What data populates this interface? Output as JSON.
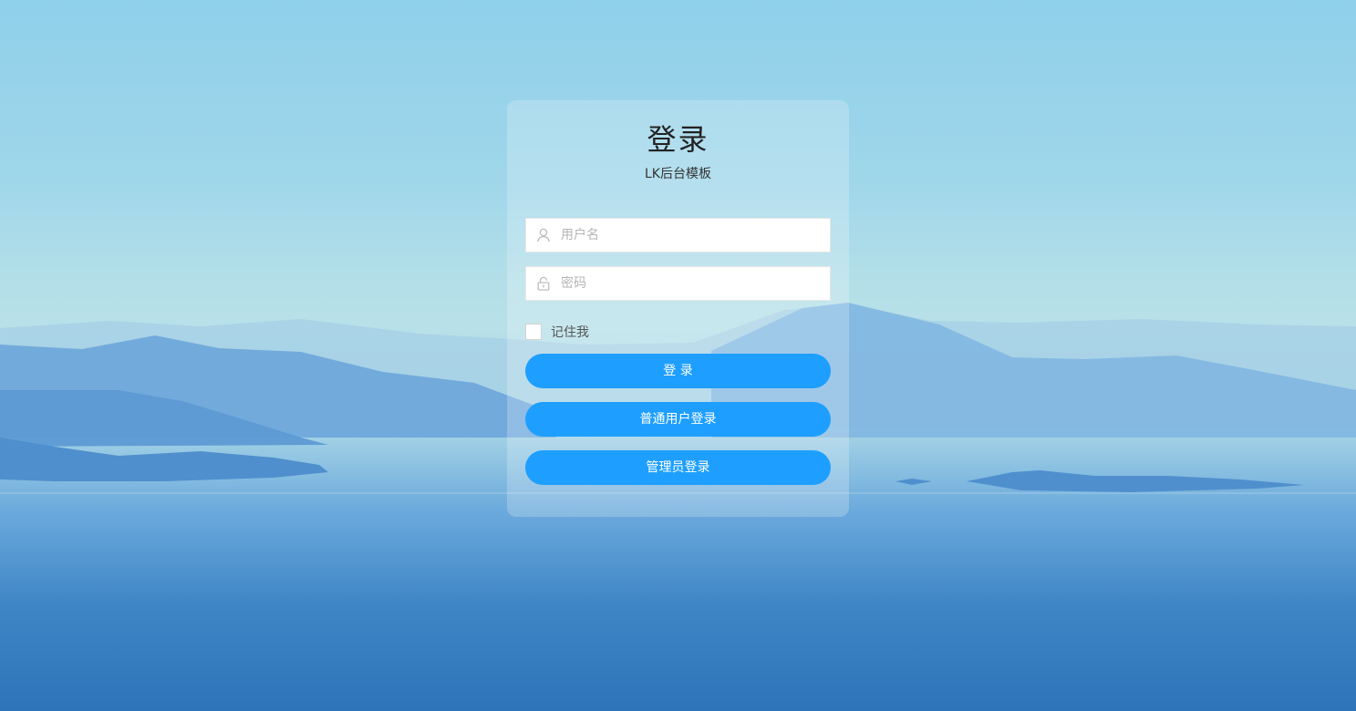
{
  "login": {
    "title": "登录",
    "subtitle": "LK后台模板",
    "username": {
      "placeholder": "用户名",
      "value": "",
      "icon": "user-icon"
    },
    "password": {
      "placeholder": "密码",
      "value": "",
      "icon": "lock-icon"
    },
    "remember": {
      "label": "记住我",
      "checked": false
    },
    "buttons": {
      "login": "登 录",
      "user_login": "普通用户登录",
      "admin_login": "管理员登录"
    }
  },
  "colors": {
    "primary": "#1e9fff"
  }
}
